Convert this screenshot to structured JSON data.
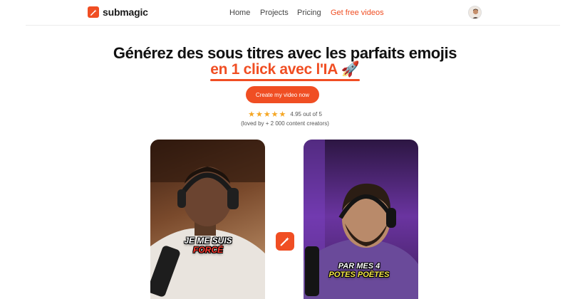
{
  "brand": {
    "name": "submagic",
    "color": "#f04e23"
  },
  "nav": {
    "items": [
      {
        "label": "Home"
      },
      {
        "label": "Projects"
      },
      {
        "label": "Pricing"
      },
      {
        "label": "Get free videos"
      }
    ]
  },
  "hero": {
    "title": "Générez des sous titres avec les parfaits emojis",
    "subtitle": "en 1 click avec l'IA 🚀",
    "cta_label": "Create my video now",
    "rating": {
      "stars": "★★★★★",
      "text": "4.95 out of 5"
    },
    "loved_text": "(loved by + 2 000 content creators)"
  },
  "videos": [
    {
      "caption_line1": "JE ME SUIS",
      "caption_line2": "FORCÉ"
    },
    {
      "caption_line1": "PAR MES 4",
      "caption_line2": "POTES POÈTES"
    }
  ],
  "icons": {
    "logo": "wand-icon",
    "center": "wand-icon",
    "avatar": "user-avatar"
  }
}
